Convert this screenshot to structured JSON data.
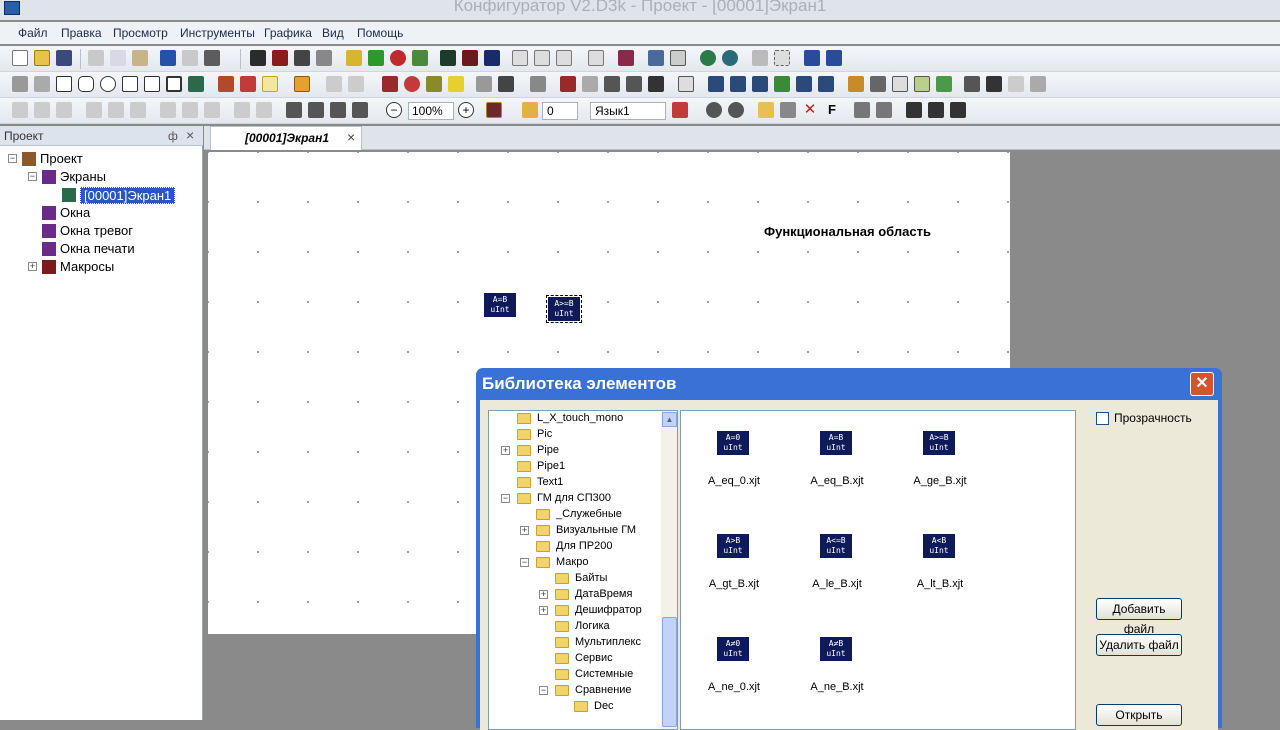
{
  "window": {
    "title": "Конфигуратор V2.D3k - Проект - [00001]Экран1"
  },
  "menu": [
    "Файл",
    "Правка",
    "Просмотр",
    "Инструменты",
    "Графика",
    "Вид",
    "Помощь"
  ],
  "toolbar3": {
    "zoom": "100%",
    "angle": "0",
    "language": "Язык1"
  },
  "project_panel": {
    "title": "Проект",
    "pin": "ф",
    "close": "×",
    "tree": [
      {
        "label": "Проект",
        "level": 0,
        "expander": "−",
        "icon": "home-icon"
      },
      {
        "label": "Экраны",
        "level": 1,
        "expander": "−",
        "icon": "screens-icon"
      },
      {
        "label": "[00001]Экран1",
        "level": 2,
        "expander": "",
        "icon": "screen-icon",
        "selected": true
      },
      {
        "label": "Окна",
        "level": 1,
        "expander": "",
        "icon": "windows-icon"
      },
      {
        "label": "Окна тревог",
        "level": 1,
        "expander": "",
        "icon": "alarm-windows-icon"
      },
      {
        "label": "Окна печати",
        "level": 1,
        "expander": "",
        "icon": "print-windows-icon"
      },
      {
        "label": "Макросы",
        "level": 1,
        "expander": "+",
        "icon": "macros-icon"
      }
    ]
  },
  "doc_tab": {
    "label": "[00001]Экран1",
    "close": "×"
  },
  "canvas": {
    "area_label": "Функциональная область",
    "blocks": [
      {
        "line1": "A=B",
        "line2": "uInt"
      },
      {
        "line1": "A>=B",
        "line2": "uInt"
      }
    ]
  },
  "dialog": {
    "title": "Библиотека элементов",
    "close": "✕",
    "transparency_label": "Прозрачность",
    "add_file": "Добавить файл",
    "remove_file": "Удалить файл",
    "open": "Открыть",
    "tree": [
      {
        "label": "L_X_touch_mono",
        "level": 0,
        "expander": ""
      },
      {
        "label": "Pic",
        "level": 0,
        "expander": ""
      },
      {
        "label": "Pipe",
        "level": 0,
        "expander": "+"
      },
      {
        "label": "Pipe1",
        "level": 0,
        "expander": ""
      },
      {
        "label": "Text1",
        "level": 0,
        "expander": ""
      },
      {
        "label": "ГМ для СП300",
        "level": 0,
        "expander": "−"
      },
      {
        "label": "_Служебные",
        "level": 1,
        "expander": ""
      },
      {
        "label": "Визуальные ГМ",
        "level": 1,
        "expander": "+"
      },
      {
        "label": "Для ПР200",
        "level": 1,
        "expander": ""
      },
      {
        "label": "Макро",
        "level": 1,
        "expander": "−"
      },
      {
        "label": "Байты",
        "level": 2,
        "expander": ""
      },
      {
        "label": "ДатаВремя",
        "level": 2,
        "expander": "+"
      },
      {
        "label": "Дешифратор",
        "level": 2,
        "expander": "+"
      },
      {
        "label": "Логика",
        "level": 2,
        "expander": ""
      },
      {
        "label": "Мультиплекс",
        "level": 2,
        "expander": ""
      },
      {
        "label": "Сервис",
        "level": 2,
        "expander": ""
      },
      {
        "label": "Системные",
        "level": 2,
        "expander": ""
      },
      {
        "label": "Сравнение",
        "level": 2,
        "expander": "−"
      },
      {
        "label": "Dec",
        "level": 3,
        "expander": ""
      }
    ],
    "files": [
      {
        "name": "A_eq_0.xjt",
        "line1": "A=0",
        "line2": "uInt"
      },
      {
        "name": "A_eq_B.xjt",
        "line1": "A=B",
        "line2": "uInt"
      },
      {
        "name": "A_ge_B.xjt",
        "line1": "A>=B",
        "line2": "uInt"
      },
      {
        "name": "A_gt_B.xjt",
        "line1": "A>B",
        "line2": "uInt"
      },
      {
        "name": "A_le_B.xjt",
        "line1": "A<=B",
        "line2": "uInt"
      },
      {
        "name": "A_lt_B.xjt",
        "line1": "A<B",
        "line2": "uInt"
      },
      {
        "name": "A_ne_0.xjt",
        "line1": "A≠0",
        "line2": "uInt"
      },
      {
        "name": "A_ne_B.xjt",
        "line1": "A≠B",
        "line2": "uInt"
      }
    ]
  }
}
